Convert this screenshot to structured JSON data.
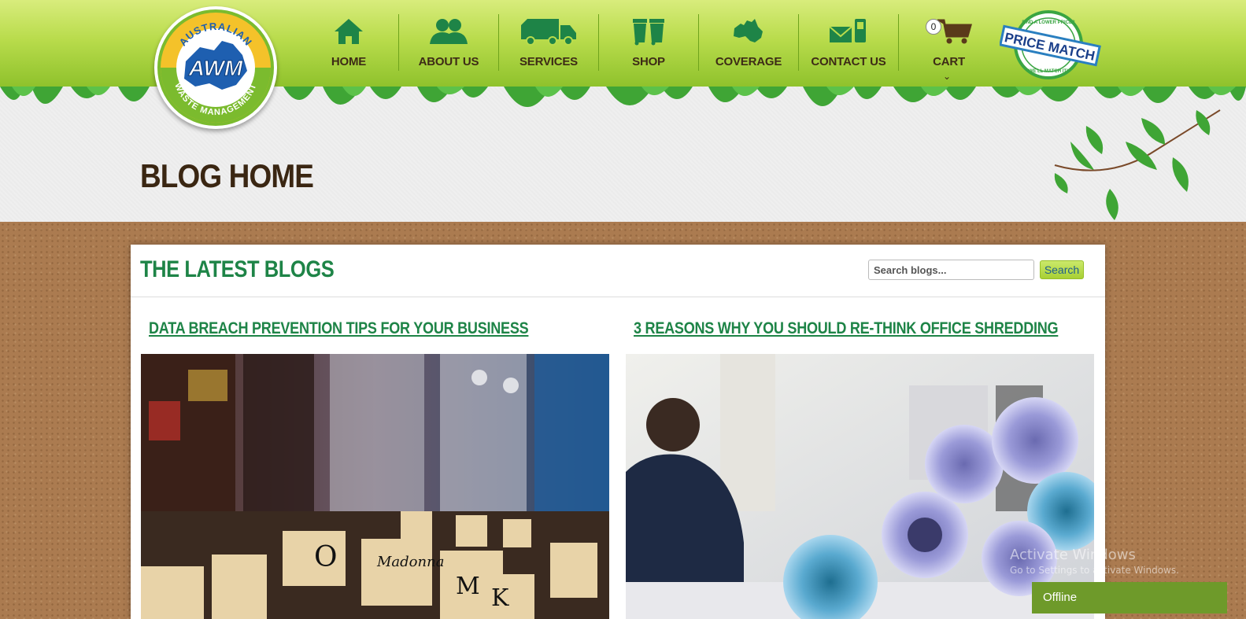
{
  "logo": {
    "brand_top": "AUSTRALIAN",
    "brand_bottom": "WASTE MANAGEMENT",
    "monogram": "AWM"
  },
  "nav": {
    "items": [
      {
        "label": "HOME",
        "icon": "house-icon"
      },
      {
        "label": "ABOUT US",
        "icon": "people-icon"
      },
      {
        "label": "SERVICES",
        "icon": "truck-icon"
      },
      {
        "label": "SHOP",
        "icon": "bins-icon"
      },
      {
        "label": "COVERAGE",
        "icon": "australia-map-icon"
      },
      {
        "label": "CONTACT US",
        "icon": "envelope-phone-icon"
      },
      {
        "label": "CART",
        "icon": "shopping-cart-icon",
        "count": "0"
      }
    ]
  },
  "price_match": {
    "main": "PRICE MATCH",
    "top": "FIND A LOWER PRICE?",
    "bottom": "WE'LL MATCH IT!"
  },
  "page": {
    "title": "BLOG HOME"
  },
  "blog": {
    "heading": "THE LATEST BLOGS",
    "search_placeholder": "Search blogs...",
    "search_button": "Search",
    "posts": [
      {
        "title": "DATA BREACH PREVENTION TIPS FOR YOUR BUSINESS",
        "image": "record-store-photo"
      },
      {
        "title": "3 REASONS WHY YOU SHOULD RE-THINK OFFICE SHREDDING",
        "image": "rolled-papers-office-photo"
      }
    ]
  },
  "watermark": {
    "line1": "Activate Windows",
    "line2": "Go to Settings to activate Windows."
  },
  "chat": {
    "status": "Offline"
  },
  "colors": {
    "nav_green": "#b9dc4c",
    "heading_green": "#1e8447",
    "title_brown": "#3a2612",
    "cork": "#ab7b50",
    "chat_green": "#6e9a2a"
  }
}
